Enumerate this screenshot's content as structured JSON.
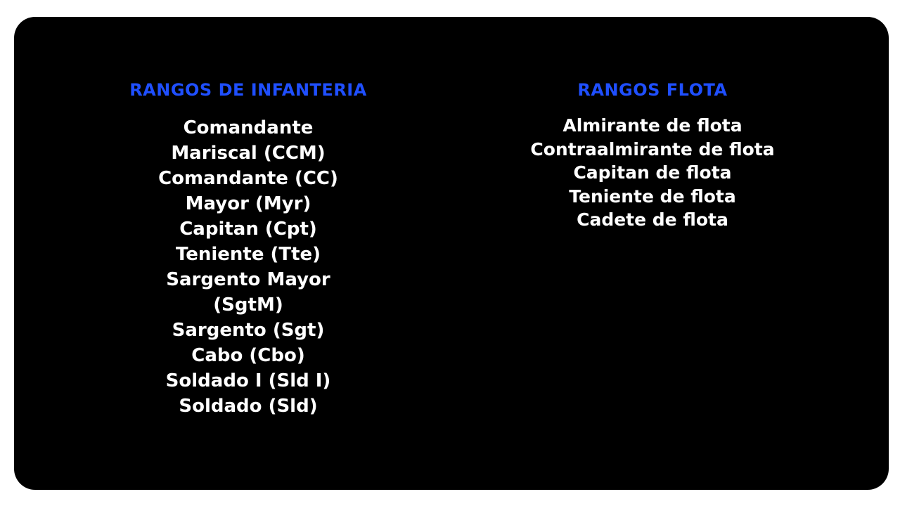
{
  "colors": {
    "background": "#000000",
    "heading": "#1f4fff",
    "text": "#ffffff"
  },
  "infantry": {
    "title": "RANGOS DE INFANTERIA",
    "ranks": [
      "Comandante Mariscal (CCM)",
      "Comandante (CC)",
      "Mayor (Myr)",
      "Capitan (Cpt)",
      "Teniente (Tte)",
      "Sargento Mayor (SgtM)",
      "Sargento (Sgt)",
      "Cabo (Cbo)",
      "Soldado I (Sld I)",
      "Soldado (Sld)"
    ]
  },
  "fleet": {
    "title": "RANGOS FLOTA",
    "ranks": [
      "Almirante de flota",
      "Contraalmirante de flota",
      "Capitan de flota",
      "Teniente de flota",
      "Cadete de flota"
    ]
  }
}
